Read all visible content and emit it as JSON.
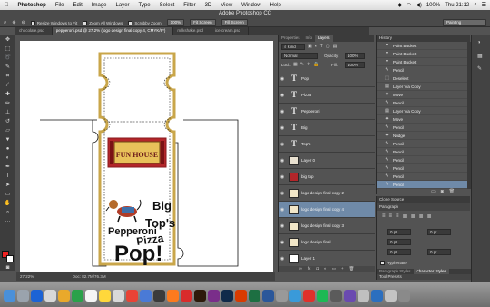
{
  "menubar": {
    "apple": "",
    "app": "Photoshop",
    "items": [
      "File",
      "Edit",
      "Image",
      "Layer",
      "Type",
      "Select",
      "Filter",
      "3D",
      "View",
      "Window",
      "Help"
    ],
    "battery": "100%",
    "clock": "Thu 21:12"
  },
  "window_title": "Adobe Photoshop CC",
  "options": {
    "resize_windows": "Resize Windows to Fit",
    "zoom_all": "Zoom All Windows",
    "scrubby": "Scrubby Zoom",
    "zoom_percent": "100%",
    "fit_screen": "Fit Screen",
    "fill_screen": "Fill Screen",
    "workspace": "Painting"
  },
  "tabs": [
    "chocolate.psd",
    "pepperoni.psd @ 27.2% (logo design final copy 4, CMYK/8*)",
    "milkshake.psd",
    "ice cream.psd"
  ],
  "canvas": {
    "sign_text": "FUN HOUSE",
    "logo_big": "Big",
    "logo_tops": "Top's",
    "logo_pizza": "Pizza",
    "logo_pepperoni": "Pepperoni",
    "logo_pop": "Pop!"
  },
  "status": {
    "zoom": "27.22%",
    "doc": "Doc: 82.7M/76.3M"
  },
  "layers_panel": {
    "tabs": [
      "Properties",
      "Info",
      "Layers"
    ],
    "kind": "Kind",
    "blend_mode": "Normal",
    "opacity_label": "Opacity:",
    "opacity": "100%",
    "lock_label": "Lock:",
    "fill_label": "Fill:",
    "fill": "100%",
    "layers": [
      {
        "name": "Pop!",
        "kind": "text"
      },
      {
        "name": "Pizza",
        "kind": "text"
      },
      {
        "name": "Pepperoni",
        "kind": "text"
      },
      {
        "name": "Big",
        "kind": "text"
      },
      {
        "name": "Top's",
        "kind": "text"
      },
      {
        "name": "Layer 0",
        "kind": "image"
      },
      {
        "name": "big top",
        "kind": "image"
      },
      {
        "name": "logo design final copy 2",
        "kind": "image"
      },
      {
        "name": "logo design final copy 4",
        "kind": "image"
      },
      {
        "name": "logo design final copy 3",
        "kind": "image"
      },
      {
        "name": "logo design final",
        "kind": "image"
      },
      {
        "name": "Layer 1",
        "kind": "image"
      }
    ],
    "selected_index": 8
  },
  "history_panel": {
    "title": "History",
    "items": [
      "Paint Bucket",
      "Paint Bucket",
      "Paint Bucket",
      "Pencil",
      "Deselect",
      "Layer Via Copy",
      "Move",
      "Pencil",
      "Layer Via Copy",
      "Move",
      "Pencil",
      "Nudge",
      "Pencil",
      "Pencil",
      "Pencil",
      "Pencil",
      "Pencil",
      "Pencil"
    ],
    "selected_index": 17
  },
  "para_panel": {
    "clone_source": "Clone Source",
    "title": "Paragraph",
    "fields": [
      "0 pt",
      "0 pt",
      "0 pt",
      "0 pt",
      "0 pt"
    ],
    "hyphenate": "Hyphenate",
    "tab_paragraph_styles": "Paragraph Styles",
    "tab_character_styles": "Character Styles",
    "tool_presets": "Tool Presets"
  },
  "colors": {
    "selection": "#6f8aa8",
    "panel": "#535353",
    "sign_red": "#b3262a",
    "sign_gold": "#d9b24a"
  }
}
